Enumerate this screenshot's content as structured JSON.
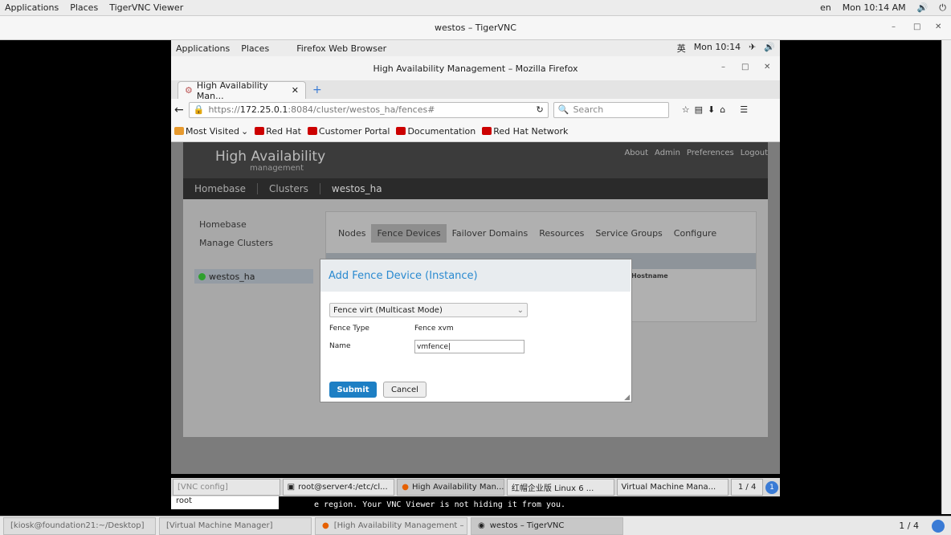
{
  "outer_topbar": {
    "applications": "Applications",
    "places": "Places",
    "app": "TigerVNC Viewer",
    "lang": "en",
    "clock": "Mon 10:14 AM"
  },
  "outer_window": {
    "title": "westos – TigerVNC"
  },
  "outer_taskbar": {
    "items": [
      {
        "label": "[kiosk@foundation21:~/Desktop]"
      },
      {
        "label": "[Virtual Machine Manager]"
      },
      {
        "label": "[High Availability Management – ..."
      },
      {
        "label": "westos – TigerVNC"
      }
    ],
    "pager": "1 / 4"
  },
  "inner_topbar": {
    "applications": "Applications",
    "places": "Places",
    "app": "Firefox Web Browser",
    "lang": "英",
    "clock": "Mon 10:14"
  },
  "firefox": {
    "title": "High Availability Management – Mozilla Firefox",
    "tab": "High Availability Man...",
    "url_prefix": "https://",
    "url_host": "172.25.0.1",
    "url_rest": ":8084/cluster/westos_ha/fences#",
    "search_placeholder": "Search",
    "bookmarks": [
      "Most Visited",
      "Red Hat",
      "Customer Portal",
      "Documentation",
      "Red Hat Network"
    ]
  },
  "app": {
    "logo_main": "High Availability",
    "logo_sub": "management",
    "top_links": [
      "About",
      "Admin",
      "Preferences",
      "Logout"
    ],
    "breadcrumb": [
      "Homebase",
      "Clusters",
      "westos_ha"
    ],
    "sidebar": [
      "Homebase",
      "Manage Clusters"
    ],
    "cluster": "westos_ha",
    "cluster_status_color": "#2ea02e",
    "tabs": [
      "Nodes",
      "Fence Devices",
      "Failover Domains",
      "Resources",
      "Service Groups",
      "Configure"
    ],
    "active_tab": "Fence Devices",
    "table_header": "Hostname"
  },
  "modal": {
    "title": "Add Fence Device (Instance)",
    "select_value": "Fence virt (Multicast Mode)",
    "fence_type_label": "Fence Type",
    "fence_type_value": "Fence xvm",
    "name_label": "Name",
    "name_value": "vmfence",
    "submit": "Submit",
    "cancel": "Cancel"
  },
  "inner_taskbar": {
    "items": [
      "[VNC config]",
      "root@server4:/etc/cl...",
      "High Availability Man...",
      "红帽企业版 Linux 6 ...",
      "Virtual Machine Mana..."
    ],
    "pager": "1 / 4",
    "notify": "1"
  },
  "terminal": {
    "input": "root",
    "text": "e region. Your VNC Viewer is not hiding it from you."
  }
}
